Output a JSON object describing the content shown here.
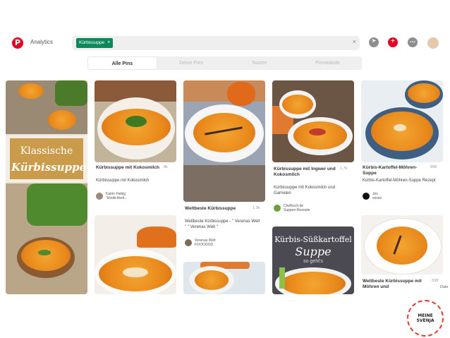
{
  "header": {
    "logo_letter": "P",
    "analytics": "Analytics",
    "search_chip": "Kürbissuppe",
    "chip_close": "×",
    "clear": "×"
  },
  "tabs": [
    "Alle Pins",
    "Deine Pins",
    "Nutzer",
    "Pinnwände"
  ],
  "collage": {
    "klassische": "Klassische",
    "kurbissuppe": "Kürbissuppe"
  },
  "pins": [
    {
      "title": "Kürbissuppe mit Kokosmilch",
      "desc": "Kürbissuppe mit Kokosmilch",
      "stat": "8k",
      "user1": "Katrin Fiebig",
      "user2": "\"köstlichkeit..."
    },
    {
      "title": "Weltbeste Kürbissuppe",
      "desc": "Weltbeste Kürbissuppe - \" Verenas Welt \" \" Verenas Welt \"",
      "stat": "1,3k",
      "user1": "Verenas Welt",
      "user2": "FOOOOOD"
    },
    {
      "title": "Kürbissuppe mit Ingwer und Kokosmilch",
      "desc": "Kürbissuppe mit Kokosmilch und Garnelen",
      "stat": "1,7k",
      "user1": "Chefkoch.de",
      "user2": "Suppen-Rezepte"
    },
    {
      "title": "Kürbis-Kartoffel-Möhren-Suppe",
      "desc": "Kürbis-Kartoffel-Möhren-Suppe Rezept",
      "stat": "848",
      "user1": "Jes",
      "user2": "essen"
    },
    {
      "title": "Weltbeste Kürbissuppe mit Möhren und",
      "stat": "338"
    }
  ],
  "overlay_pin": {
    "line1": "Kürbis-Süßkartoffel",
    "line2": "Suppe",
    "line3": "so geht's"
  },
  "edge_text": "Date",
  "stamp": "MEINE SVENJA",
  "colors": {
    "brand": "#e60023",
    "chip": "#0a8a5c"
  }
}
